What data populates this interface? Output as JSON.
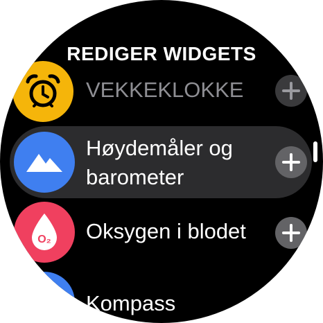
{
  "header": {
    "title": "REDIGER WIDGETS"
  },
  "widgets": [
    {
      "label": "VEKKEKLOKKE",
      "icon": "alarm-clock-icon",
      "color": "#f5b50a",
      "add_icon": "plus-icon"
    },
    {
      "label_line1": "Høydemåler og",
      "label_line2": "barometer",
      "icon": "mountain-icon",
      "color": "#3f7ff0",
      "add_icon": "plus-icon"
    },
    {
      "label": "Oksygen i blodet",
      "icon": "blood-oxygen-icon",
      "icon_text": "O₂",
      "color": "#f0405f",
      "add_icon": "plus-icon"
    },
    {
      "label": "Kompass",
      "icon": "compass-icon",
      "color": "#3f7ff0"
    }
  ],
  "colors": {
    "background": "#000000",
    "highlight": "#2c2c2e",
    "add_button": "#636366"
  }
}
